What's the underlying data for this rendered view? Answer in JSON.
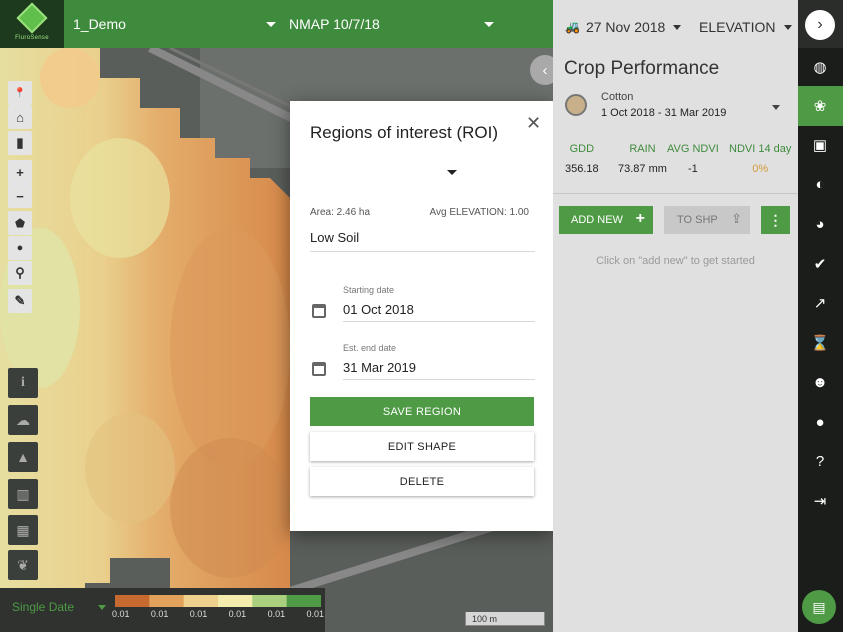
{
  "topbar": {
    "logo_text": "FluroSense",
    "farm_select": "1_Demo",
    "layer_select": "NMAP 10/7/18"
  },
  "map_tools": {
    "pin": "📍",
    "home": "⌂",
    "ruler": "▮",
    "zoom_in": "+",
    "zoom_out": "−",
    "polygon": "⬟",
    "circle": "●",
    "marker": "⚲",
    "edit": "✎",
    "info": "i",
    "weather": "☁",
    "warning": "▲",
    "chart": "▥",
    "layers": "▦",
    "leaf": "❦"
  },
  "legend": {
    "type": "Single Date",
    "ticks": [
      "0.01",
      "0.01",
      "0.01",
      "0.01",
      "0.01",
      "0.01"
    ],
    "gradient": [
      "#c76a2f",
      "#e2a25b",
      "#efd08c",
      "#f4ecac",
      "#a9cf7f",
      "#4e9a45"
    ]
  },
  "scale": "100 m",
  "modal": {
    "title": "Regions of interest (ROI)",
    "close": "✕",
    "area_label": "Area: 2.46 ha",
    "avg_label": "Avg ELEVATION: 1.00",
    "region_name": "Low Soil",
    "start_label": "Starting date",
    "start_value": "01 Oct 2018",
    "end_label": "Est. end date",
    "end_value": "31 Mar 2019",
    "save": "SAVE REGION",
    "edit": "EDIT SHAPE",
    "delete": "DELETE"
  },
  "panel": {
    "date": "27 Nov 2018",
    "layer": "ELEVATION",
    "title": "Crop Performance",
    "crop": "Cotton",
    "crop_range": "1 Oct 2018 - 31 Mar 2019",
    "stats": [
      {
        "label": "GDD",
        "value": "356.18"
      },
      {
        "label": "RAIN",
        "value": "73.87 mm"
      },
      {
        "label": "AVG NDVI",
        "value": "-1"
      },
      {
        "label": "NDVI 14 day",
        "value": "0%"
      }
    ],
    "add_new": "ADD NEW",
    "to_shp": "TO SHP",
    "hint": "Click on \"add new\" to get started"
  },
  "rail": {
    "next": "›",
    "chat": "▤"
  },
  "colors": {
    "accent": "#4e9a45",
    "topbar": "#3f8b3d",
    "ndvi_pct": "#d49a3a"
  }
}
